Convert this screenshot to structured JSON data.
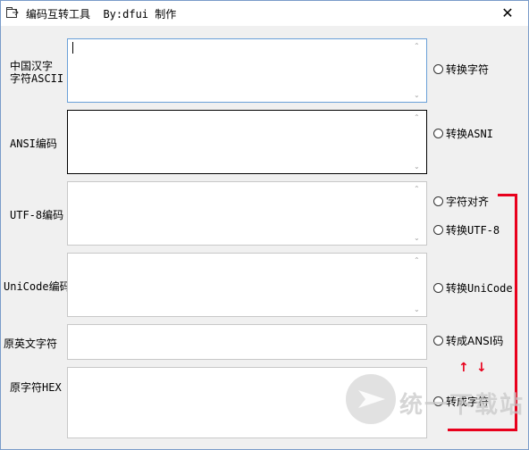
{
  "window": {
    "title": "编码互转工具  By:dfui 制作",
    "close_glyph": "✕"
  },
  "rows": [
    {
      "label_line1": "中国汉字",
      "label_line2": "字符ASCII",
      "value": ""
    },
    {
      "label": "ANSI编码",
      "value": ""
    },
    {
      "label": "UTF-8编码",
      "value": ""
    },
    {
      "label": "UniCode编码",
      "value": ""
    },
    {
      "label": "原英文字符",
      "value": ""
    },
    {
      "label": "原字符HEX",
      "value": ""
    }
  ],
  "options": [
    {
      "label": "转换字符"
    },
    {
      "label": "转换ASNI"
    },
    {
      "label": "字符对齐"
    },
    {
      "label": "转换UTF-8"
    },
    {
      "label": "转换UniCode"
    },
    {
      "label": "转成ANSI码"
    },
    {
      "label": "转成字符"
    }
  ],
  "annotation_color": "#e8001c",
  "watermark": {
    "text": "统一下载站"
  }
}
